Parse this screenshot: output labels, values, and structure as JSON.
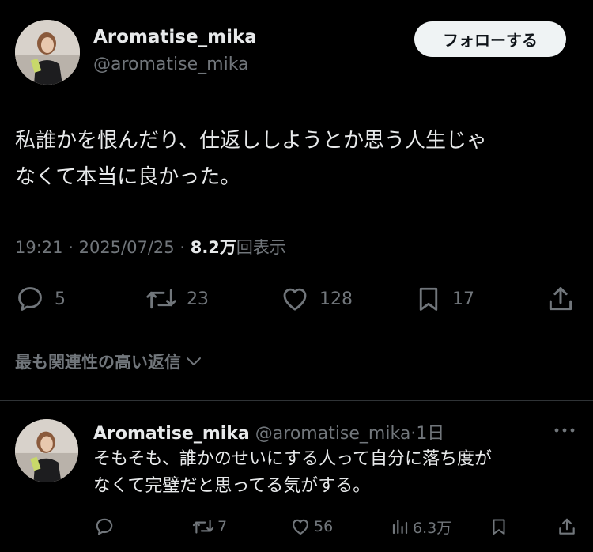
{
  "tweet": {
    "display_name": "Aromatise_mika",
    "handle": "@aromatise_mika",
    "follow_label": "フォローする",
    "text_lines": [
      "私誰かを恨んだり、仕返ししようとか思う人生じゃ",
      "なくて本当に良かった。"
    ],
    "time": "19:21",
    "date": "2025/07/25",
    "separator": "·",
    "views_count": "8.2万",
    "views_label": "回表示",
    "stats": {
      "replies": "5",
      "reposts": "23",
      "likes": "128",
      "bookmarks": "17"
    }
  },
  "replies_sort": {
    "label": "最も関連性の高い返信"
  },
  "reply": {
    "display_name": "Aromatise_mika",
    "handle": "@aromatise_mika",
    "separator": "·",
    "age": "1日",
    "text_lines": [
      "そもそも、誰かのせいにする人って自分に落ち度が",
      "なくて完璧だと思ってる気がする。"
    ],
    "stats": {
      "replies": "",
      "reposts": "7",
      "likes": "56",
      "views": "6.3万"
    }
  },
  "icons": {
    "reply": "speech-bubble-icon",
    "repost": "repost-arrows-icon",
    "like": "heart-icon",
    "bookmark": "bookmark-icon",
    "share": "share-upload-icon",
    "views": "bar-chart-icon",
    "more": "ellipsis-icon",
    "sort": "chevron-down-icon"
  },
  "colors": {
    "background": "#000000",
    "text_primary": "#e7e9ea",
    "text_secondary": "#71767b",
    "follow_button_bg": "#eff3f4",
    "divider": "#2f3336"
  }
}
